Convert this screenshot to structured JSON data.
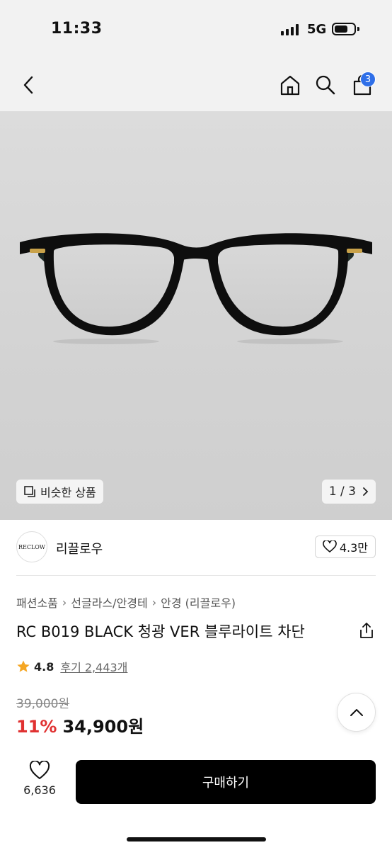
{
  "status_bar": {
    "time": "11:33",
    "network": "5G"
  },
  "header": {
    "cart_count": "3"
  },
  "gallery": {
    "similar_label": "비슷한 상품",
    "pager": "1 / 3"
  },
  "store": {
    "logo_text": "RECLOW",
    "name": "리끌로우",
    "likes": "4.3만"
  },
  "breadcrumb": [
    "패션소품",
    "선글라스/안경테",
    "안경 (리끌로우)"
  ],
  "product": {
    "title": "RC B019 BLACK 청광 VER 블루라이트 차단",
    "rating": "4.8",
    "reviews": "후기 2,443개",
    "original_price": "39,000원",
    "discount": "11%",
    "price": "34,900원"
  },
  "bottom_bar": {
    "wish_count": "6,636",
    "buy_label": "구매하기"
  },
  "colors": {
    "badge": "#2f6fe8",
    "discount": "#e03131",
    "star": "#f5a623",
    "buy_button": "#000000"
  }
}
